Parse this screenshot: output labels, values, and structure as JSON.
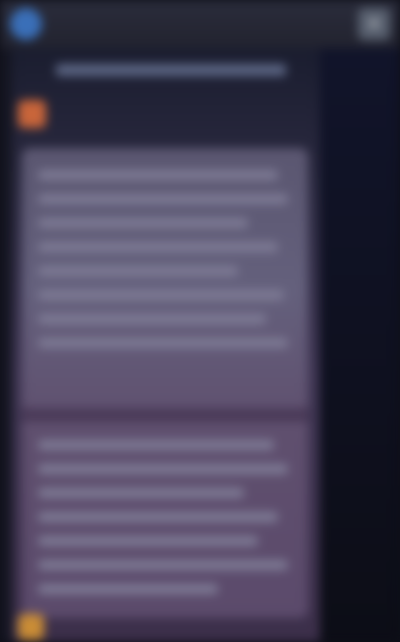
{
  "app": {
    "title": "",
    "top_action_icon": "plus-icon"
  },
  "colors": {
    "topbar": "#2a2c3b",
    "avatar": "#3a6fb8",
    "feed_bg": "#3e3552",
    "card_bg": "#64607c",
    "post_avatar": "#c8653a",
    "bottom_avatar": "#c98c36"
  },
  "post": {
    "author": ""
  }
}
